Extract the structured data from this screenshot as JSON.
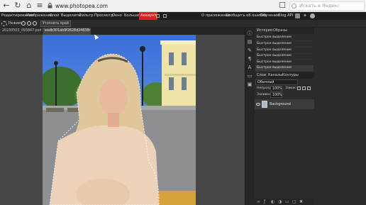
{
  "browser": {
    "url": "www.photopea.com",
    "search_placeholder": "Искать в Яндекс"
  },
  "menu": {
    "items": [
      "Редактирование",
      "Изображение",
      "Слой",
      "Выделить",
      "Фильтр",
      "Просмотр",
      "Окно",
      "Больше"
    ],
    "account": "Аккаунт",
    "right_items": [
      "О приложении",
      "Сообщить об ошибке",
      "Обучение",
      "Blog",
      "API"
    ]
  },
  "options": {
    "mode_label": "Режим:",
    "refine_button": "Уточнить край"
  },
  "tabs": [
    "20230503_093847.psd",
    "eadb301ab9f2628d24838r"
  ],
  "panels": {
    "history_tab": "История",
    "swatches_tab": "Образы",
    "history_items": [
      "Быстрое выделение",
      "Быстрое выделение",
      "Быстрое выделение",
      "Быстрое выделение",
      "Быстрое выделение",
      "Быстрое выделение"
    ],
    "layers_tab": "Слои",
    "channels_tab": "Каналы",
    "paths_tab": "Контуры",
    "blend_mode": "Обычный",
    "opacity_label": "Непрозр:",
    "opacity_value": "100%",
    "lock_label": "Замок:",
    "fill_label": "Заливка:",
    "fill_value": "100%",
    "layer_name": "Background"
  },
  "colors": {
    "accent": "#e31e1e",
    "menubar": "#1d1d1d",
    "panel": "#2b2b2b"
  }
}
